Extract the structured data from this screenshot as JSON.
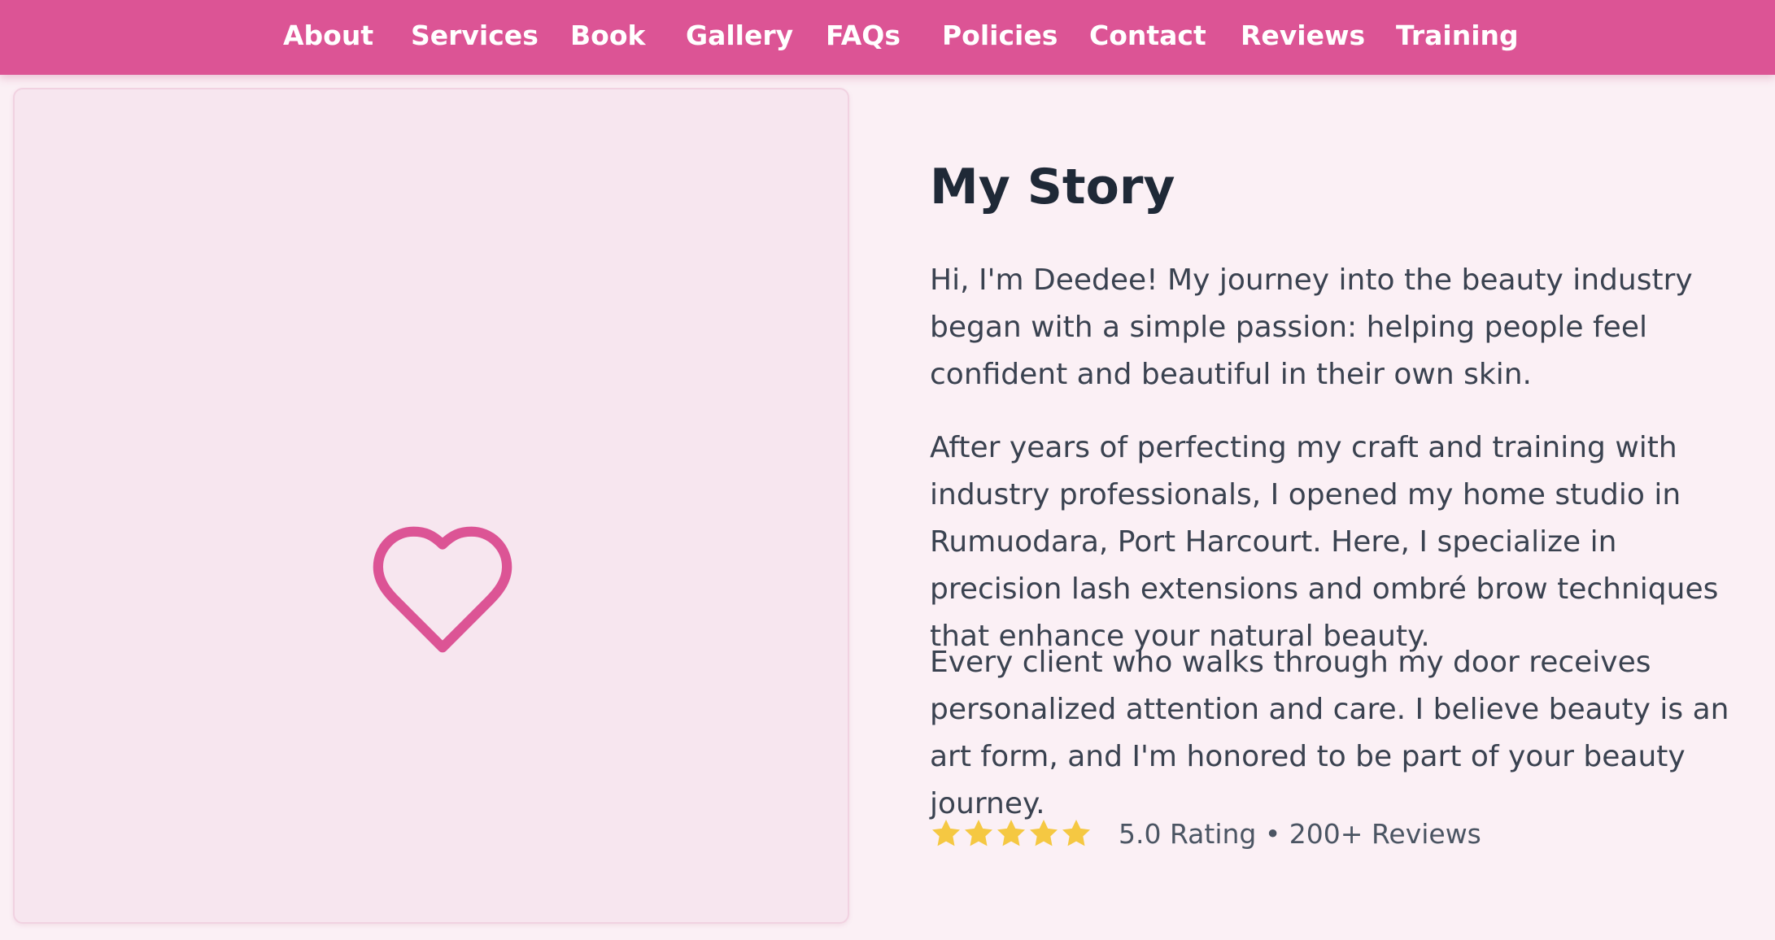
{
  "nav": {
    "items": [
      {
        "label": "About"
      },
      {
        "label": "Services"
      },
      {
        "label": "Book"
      },
      {
        "label": "Gallery"
      },
      {
        "label": "FAQs"
      },
      {
        "label": "Policies"
      },
      {
        "label": "Contact"
      },
      {
        "label": "Reviews"
      },
      {
        "label": "Training"
      }
    ]
  },
  "image_card": {
    "icon": "heart-icon"
  },
  "story": {
    "title": "My Story",
    "paragraphs": [
      "Hi, I'm Deedee! My journey into the beauty industry began with a simple passion: helping people feel confident and beautiful in their own skin.",
      "After years of perfecting my craft and training with industry professionals, I opened my home studio in Rumuodara, Port Harcourt. Here, I specialize in precision lash extensions and ombré brow techniques that enhance your natural beauty.",
      "Every client who walks through my door receives personalized attention and care. I believe beauty is an art form, and I'm honored to be part of your beauty journey."
    ],
    "rating": {
      "stars": 5,
      "text": "5.0 Rating • 200+ Reviews"
    }
  },
  "colors": {
    "brand_pink": "#dc5495",
    "page_background": "#fbf0f5",
    "card_background": "#f7e6ef",
    "star_gold": "#f5c842",
    "heading": "#1f2937"
  }
}
